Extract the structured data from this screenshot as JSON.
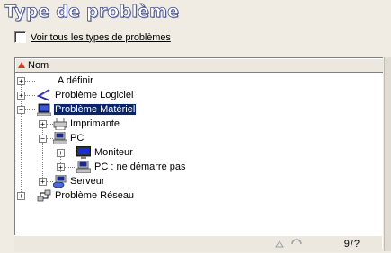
{
  "title": "Type de problème",
  "show_all_checkbox": {
    "label": "Voir tous les types de problèmes",
    "checked": false
  },
  "column_header": {
    "label": "Nom",
    "sort": "ascending"
  },
  "tree": [
    {
      "label": "A définir",
      "icon": "none",
      "level": 0,
      "expander": "+",
      "selected": false
    },
    {
      "label": "Problème Logiciel",
      "icon": "software-problem-icon",
      "level": 0,
      "expander": "+",
      "selected": false
    },
    {
      "label": "Problème Matériel",
      "icon": "hardware-problem-icon",
      "level": 0,
      "expander": "-",
      "selected": true
    },
    {
      "label": "Imprimante",
      "icon": "printer-icon",
      "level": 1,
      "expander": "+",
      "selected": false
    },
    {
      "label": "PC",
      "icon": "pc-icon",
      "level": 1,
      "expander": "-",
      "selected": false
    },
    {
      "label": "Moniteur",
      "icon": "monitor-icon",
      "level": 2,
      "expander": "+",
      "selected": false
    },
    {
      "label": "PC : ne démarre pas",
      "icon": "pc-icon",
      "level": 2,
      "expander": "+",
      "selected": false
    },
    {
      "label": "Serveur",
      "icon": "server-icon",
      "level": 1,
      "expander": "+",
      "selected": false
    },
    {
      "label": "Problème Réseau",
      "icon": "network-icon",
      "level": 0,
      "expander": "+",
      "selected": false
    }
  ],
  "status": {
    "count": "9/?"
  },
  "colors": {
    "selection": "#0a246a",
    "title_outline": "#3e4a86"
  }
}
